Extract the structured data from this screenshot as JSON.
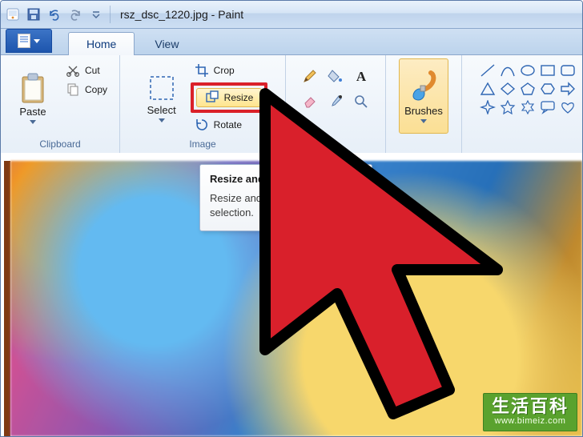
{
  "titlebar": {
    "filename": "rsz_dsc_1220.jpg",
    "appname": "Paint"
  },
  "qat": {
    "save": "save-icon",
    "undo": "undo-icon",
    "redo": "redo-icon",
    "customize": "chevron-down-icon"
  },
  "tabs": {
    "home": "Home",
    "view": "View"
  },
  "ribbon": {
    "clipboard": {
      "label": "Clipboard",
      "paste": "Paste",
      "cut": "Cut",
      "copy": "Copy"
    },
    "image": {
      "label": "Image",
      "select": "Select",
      "crop": "Crop",
      "resize": "Resize",
      "rotate": "Rotate"
    },
    "tools": {
      "pencil": "pencil-icon",
      "fill": "fill-bucket-icon",
      "text": "text-icon",
      "eraser": "eraser-icon",
      "picker": "color-picker-icon",
      "magnifier": "magnifier-icon"
    },
    "brushes": {
      "label": "Brushes"
    }
  },
  "tooltip": {
    "title": "Resize and skew",
    "body": "Resize and skew the picture or selection."
  },
  "watermark": {
    "text": "生活百科",
    "url": "www.bimeiz.com"
  }
}
